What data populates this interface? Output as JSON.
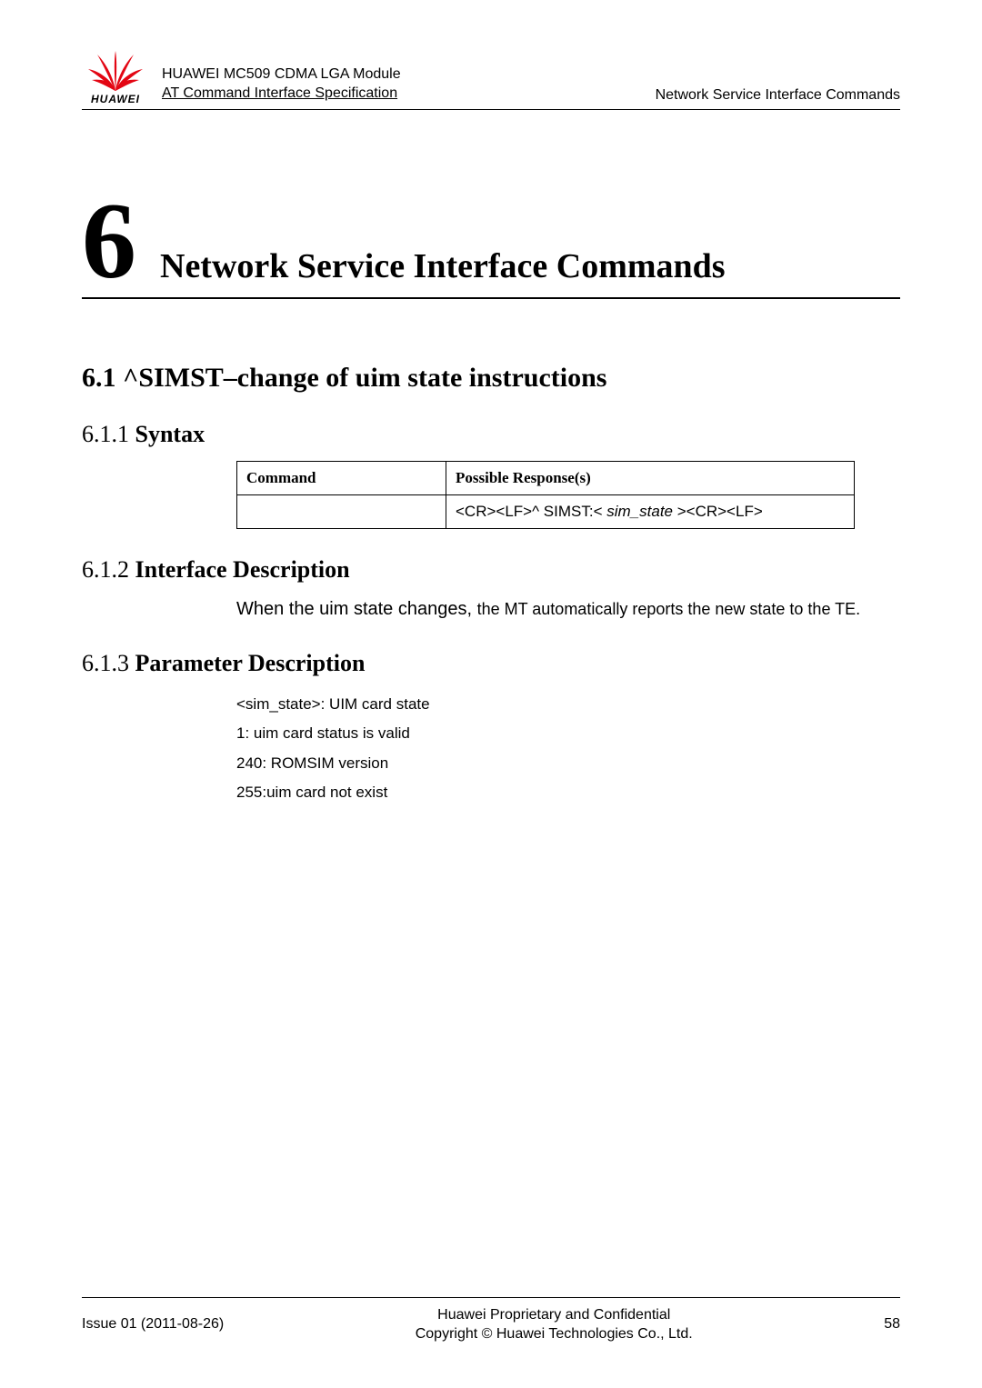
{
  "header": {
    "logo_text": "HUAWEI",
    "product_line1": "HUAWEI MC509 CDMA LGA Module",
    "product_line2": "AT Command Interface Specification",
    "right": "Network Service Interface Commands"
  },
  "chapter": {
    "number": "6",
    "title": "Network Service Interface Commands"
  },
  "section": {
    "heading": "6.1 ^SIMST–change of uim state instructions",
    "sub1_num": "6.1.1 ",
    "sub1_title": "Syntax",
    "sub2_num": "6.1.2 ",
    "sub2_title": "Interface Description",
    "sub3_num": "6.1.3 ",
    "sub3_title": "Parameter Description"
  },
  "chart_data": {
    "type": "table",
    "headers": [
      "Command",
      "Possible Response(s)"
    ],
    "rows": [
      [
        "",
        "<CR><LF>^ SIMST:< sim_state ><CR><LF>"
      ]
    ],
    "response_prefix": "<CR><LF>^ SIMST:< ",
    "response_var": "sim_state",
    "response_suffix": " ><CR><LF>"
  },
  "interface_desc": {
    "part1": "When the uim state changes, ",
    "part2": "the MT automatically reports the new state to the TE."
  },
  "params": {
    "p1": "<sim_state>: UIM card state",
    "p2": "1: uim card status is valid",
    "p3": "240: ROMSIM version",
    "p4": "255:uim card not exist"
  },
  "footer": {
    "left": "Issue 01 (2011-08-26)",
    "center1": "Huawei Proprietary and Confidential",
    "center2": "Copyright © Huawei Technologies Co., Ltd.",
    "right": "58"
  }
}
